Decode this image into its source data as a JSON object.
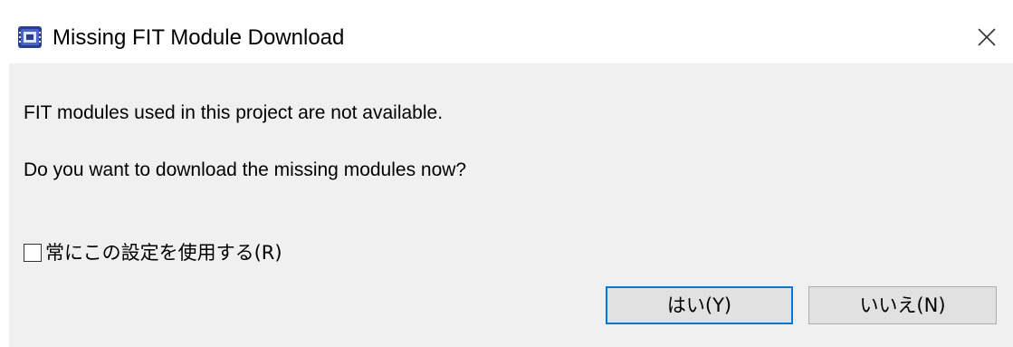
{
  "window": {
    "title": "Missing FIT Module Download",
    "icon": "app-chip-icon",
    "close_icon": "close-icon"
  },
  "message": {
    "line1": "FIT modules used in this project are not available.",
    "line2": "Do you want to download the missing modules now?"
  },
  "checkbox": {
    "label": "常にこの設定を使用する(R)",
    "checked": false
  },
  "buttons": {
    "yes_label": "はい(Y)",
    "no_label": "いいえ(N)"
  },
  "colors": {
    "panel_background": "#f0f0f0",
    "button_background": "#e1e1e1",
    "focus_border": "#0078d7"
  }
}
